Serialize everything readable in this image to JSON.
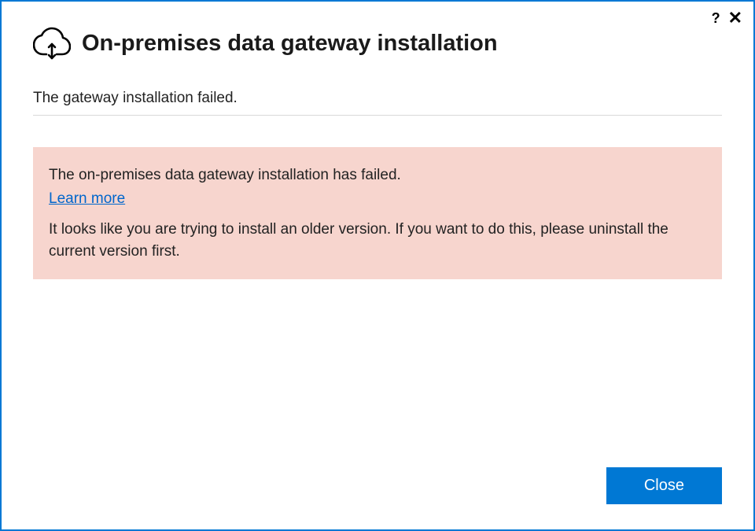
{
  "titlebar": {
    "help_glyph": "?",
    "close_glyph": "✕"
  },
  "header": {
    "title": "On-premises data gateway installation"
  },
  "status": {
    "message": "The gateway installation failed."
  },
  "error": {
    "title": "The on-premises data gateway installation has failed.",
    "learn_more_label": "Learn more",
    "detail": "It looks like you are trying to install an older version. If you want to do this, please uninstall the current version first."
  },
  "footer": {
    "close_label": "Close"
  },
  "colors": {
    "accent": "#0078d4",
    "error_bg": "#f7d5ce",
    "link": "#0066cc"
  }
}
